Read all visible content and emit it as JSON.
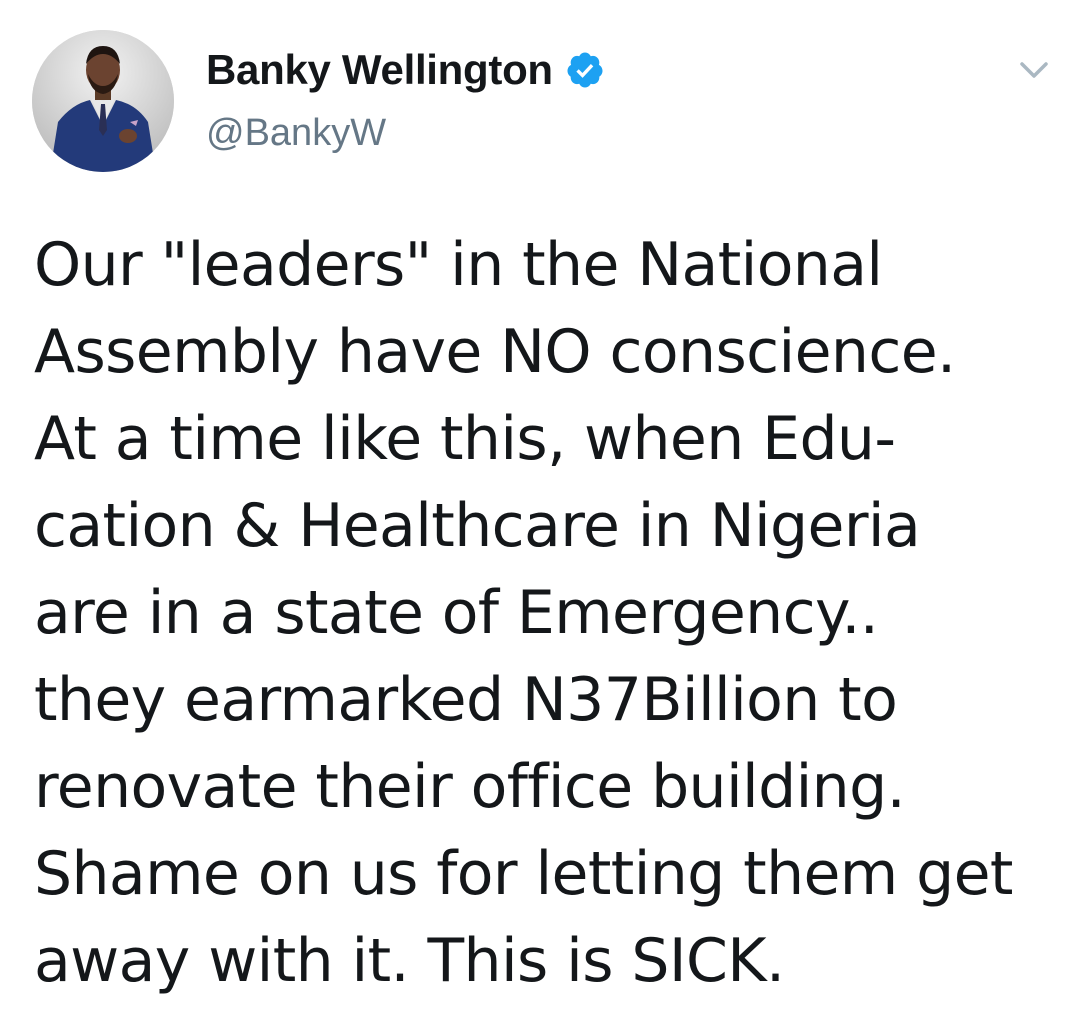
{
  "tweet": {
    "author": {
      "display_name": "Banky Wellington",
      "handle": "@BankyW",
      "verified": true
    },
    "text_lines": [
      "Our \"leaders\" in the National",
      "Assembly have NO conscience.",
      "At a time like this, when Edu-",
      "cation & Healthcare in Nigeria",
      "are in a state of Emergency..",
      "they earmarked N37Billion to",
      "renovate their office building.",
      "Shame on us for letting them get",
      "away with it. This is SICK."
    ],
    "icons": {
      "verified": "verified-badge-icon",
      "menu": "chevron-down-icon"
    }
  },
  "colors": {
    "text": "#14171a",
    "secondary_text": "#657786",
    "verified_blue": "#1da1f2",
    "caret": "#aab8c2",
    "background": "#ffffff"
  }
}
